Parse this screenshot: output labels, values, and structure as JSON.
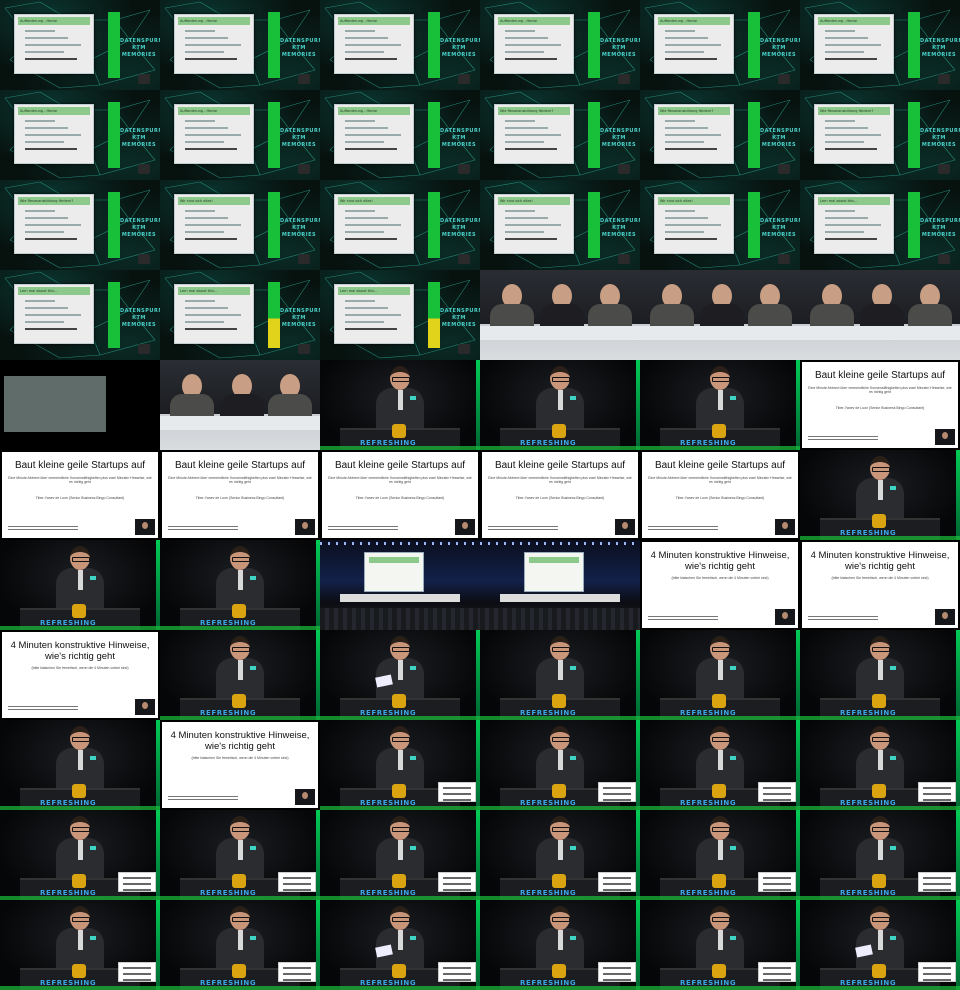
{
  "brand_text": "REFRESHING",
  "logo_text": "DATENSPURN\nKTM\nMEMORIES",
  "slides": {
    "agenda_title": "Aufforderung - Heute",
    "q_title": "Wie Resonanzbildung fördern?",
    "b_title": "Wir sind sich alles!",
    "c_title": "Lern mal about this..."
  },
  "title_slide_1": {
    "heading": "Baut kleine geile Startups auf",
    "subtitle": "Eine Minute Abbrevi über vermeintliche Konsensfähigkeiten plus zwei Minuten Hinweise, wie es richtig geht",
    "author": "Tiber-Yanev de Luon (Senior Business Bingo Consultant)"
  },
  "title_slide_2": {
    "heading": "4 Minuten konstruktive Hinweise, wie's richtig geht",
    "subtitle": "(bitte klatschen Sie frenetisch, wenn die 4 Minuten vorbei sind)"
  },
  "colors": {
    "accent_green": "#19c23b",
    "slide_header": "#8cc98b",
    "brand_blue": "#3aa7e8",
    "badge_cyan": "#3fd5c4"
  },
  "layout": [
    [
      "slide-a",
      "slide-a",
      "slide-a",
      "slide-a",
      "slide-a",
      "slide-a"
    ],
    [
      "slide-a",
      "slide-a",
      "slide-a",
      "slide-q",
      "slide-q",
      "slide-q"
    ],
    [
      "slide-q",
      "slide-b",
      "slide-b",
      "slide-b",
      "slide-b",
      "slide-c"
    ],
    [
      "slide-c",
      "slide-c-y",
      "slide-c-y",
      "panel",
      "panel",
      "panel"
    ],
    [
      "grey",
      "panel",
      "speaker",
      "speaker",
      "speaker",
      "title1"
    ],
    [
      "title1",
      "title1",
      "title1",
      "title1",
      "title1",
      "speaker"
    ],
    [
      "speaker",
      "speaker",
      "hall",
      "hall",
      "title2",
      "title2"
    ],
    [
      "title2",
      "speaker",
      "speaker-paper",
      "speaker",
      "speaker",
      "speaker"
    ],
    [
      "speaker",
      "title2",
      "speaker-lower",
      "speaker-lower",
      "speaker-lower",
      "speaker-lower"
    ],
    [
      "speaker-lower",
      "speaker-lower",
      "speaker-lower",
      "speaker-lower",
      "speaker-lower",
      "speaker-lower"
    ],
    [
      "speaker-lower",
      "speaker-lower",
      "speaker-paper-lower",
      "speaker-lower",
      "speaker-lower",
      "speaker-paper-lower"
    ]
  ]
}
